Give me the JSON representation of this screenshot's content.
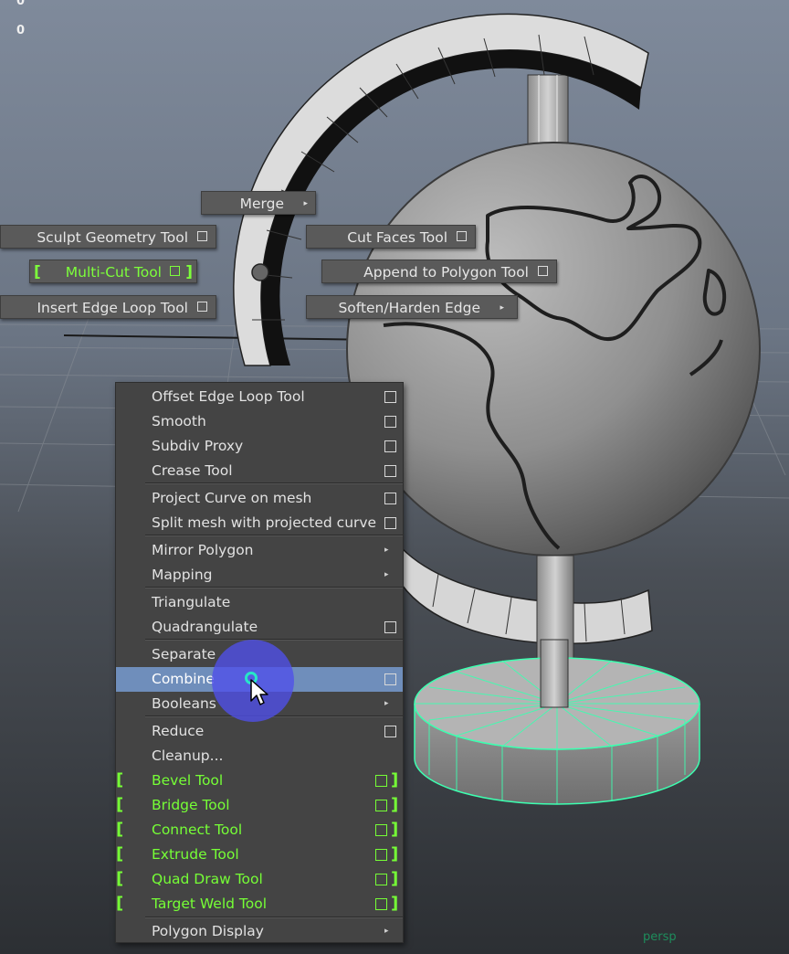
{
  "hud": {
    "line1": "0",
    "line2": "0"
  },
  "viewport": {
    "camera_label": "persp"
  },
  "marking_menu": {
    "merge": {
      "label": "Merge"
    },
    "sculpt_geometry": {
      "label": "Sculpt Geometry Tool"
    },
    "cut_faces": {
      "label": "Cut Faces Tool"
    },
    "multi_cut": {
      "label": "Multi-Cut Tool"
    },
    "append_polygon": {
      "label": "Append to Polygon Tool"
    },
    "insert_edge_loop": {
      "label": "Insert Edge Loop Tool"
    },
    "soften_harden": {
      "label": "Soften/Harden Edge"
    }
  },
  "menu": {
    "items": [
      {
        "label": "Offset Edge Loop Tool",
        "option": true
      },
      {
        "label": "Smooth",
        "option": true
      },
      {
        "label": "Subdiv Proxy",
        "option": true
      },
      {
        "label": "Crease Tool",
        "option": true
      },
      {
        "label": "Project Curve on mesh",
        "option": true
      },
      {
        "label": "Split mesh with projected curve",
        "option": true
      },
      {
        "label": "Mirror Polygon",
        "submenu": true
      },
      {
        "label": "Mapping",
        "submenu": true
      },
      {
        "label": "Triangulate"
      },
      {
        "label": "Quadrangulate",
        "option": true
      },
      {
        "label": "Separate"
      },
      {
        "label": "Combine",
        "option": true,
        "selected": true
      },
      {
        "label": "Booleans",
        "submenu": true
      },
      {
        "label": "Reduce",
        "option": true
      },
      {
        "label": "Cleanup..."
      },
      {
        "label": "Bevel Tool",
        "option": true,
        "hotbox": true
      },
      {
        "label": "Bridge Tool",
        "option": true,
        "hotbox": true
      },
      {
        "label": "Connect Tool",
        "option": true,
        "hotbox": true
      },
      {
        "label": "Extrude Tool",
        "option": true,
        "hotbox": true
      },
      {
        "label": "Quad Draw Tool",
        "option": true,
        "hotbox": true
      },
      {
        "label": "Target Weld Tool",
        "option": true,
        "hotbox": true
      },
      {
        "label": "Polygon Display",
        "submenu": true
      }
    ]
  },
  "colors": {
    "menu_bg": "#444444",
    "selection": "#6f8ebb",
    "highlight_green": "#76ff36",
    "cursor_ring": "#5050eb",
    "mesh_selection": "#3dffb0"
  },
  "icons": [
    "option-box-icon",
    "submenu-arrow-icon",
    "mouse-cursor-icon"
  ]
}
